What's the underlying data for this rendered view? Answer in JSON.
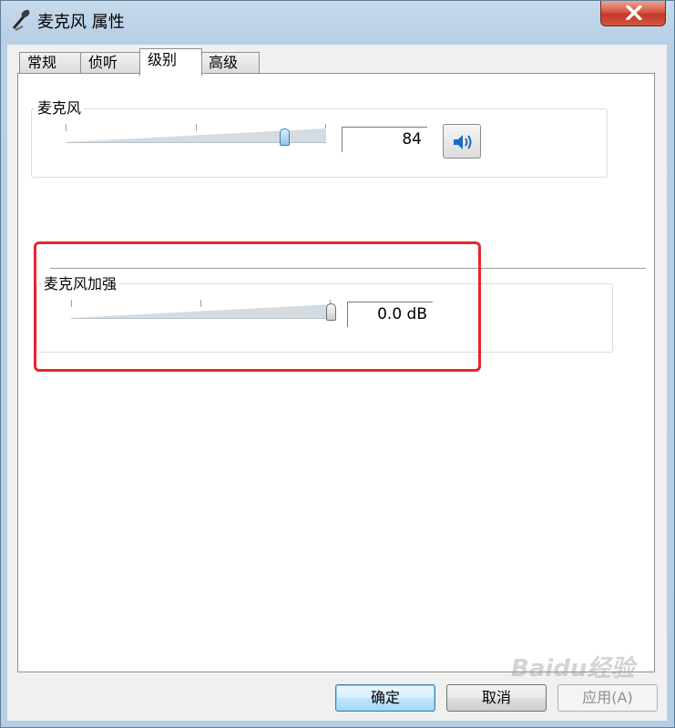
{
  "window": {
    "title": "麦克风 属性",
    "icon": "microphone-icon"
  },
  "tabs": [
    {
      "label": "常规",
      "active": false
    },
    {
      "label": "侦听",
      "active": false
    },
    {
      "label": "级别",
      "active": true
    },
    {
      "label": "高级",
      "active": false
    }
  ],
  "microphone": {
    "label": "麦克风",
    "value": "84",
    "level": 84,
    "mute_icon": "speaker-icon"
  },
  "boost": {
    "label": "麦克风加强",
    "value": "0.0 dB"
  },
  "buttons": {
    "ok": "确定",
    "cancel": "取消",
    "apply": "应用(A)"
  },
  "watermark": "Baidu经验",
  "colors": {
    "highlight": "#e8262b",
    "accent": "#3c7fb1"
  }
}
